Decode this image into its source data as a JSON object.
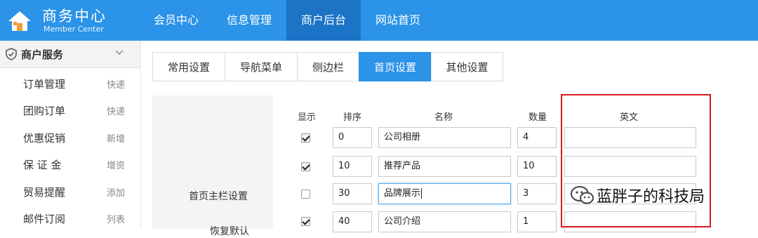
{
  "header": {
    "brand_title": "商务中心",
    "brand_subtitle": "Member Center",
    "nav": [
      {
        "label": "会员中心",
        "active": false
      },
      {
        "label": "信息管理",
        "active": false
      },
      {
        "label": "商户后台",
        "active": true
      },
      {
        "label": "网站首页",
        "active": false
      }
    ]
  },
  "sidebar": {
    "section_label": "商户服务",
    "items": [
      {
        "label": "订单管理",
        "tag": "快递"
      },
      {
        "label": "团购订单",
        "tag": "快递"
      },
      {
        "label": "优惠促销",
        "tag": "新增"
      },
      {
        "label": "保 证 金",
        "tag": "增资"
      },
      {
        "label": "贸易提醒",
        "tag": "添加"
      },
      {
        "label": "邮件订阅",
        "tag": "列表"
      }
    ]
  },
  "tabs": [
    {
      "label": "常用设置",
      "active": false
    },
    {
      "label": "导航菜单",
      "active": false
    },
    {
      "label": "侧边栏",
      "active": false
    },
    {
      "label": "首页设置",
      "active": true
    },
    {
      "label": "其他设置",
      "active": false
    }
  ],
  "settings": {
    "section_label": "首页主栏设置",
    "section_label_2": "恢复默认",
    "columns": {
      "show": "显示",
      "order": "排序",
      "name": "名称",
      "count": "数量",
      "english": "英文"
    },
    "rows": [
      {
        "show": true,
        "order": "0",
        "name": "公司相册",
        "count": "4",
        "english": ""
      },
      {
        "show": true,
        "order": "10",
        "name": "推荐产品",
        "count": "10",
        "english": ""
      },
      {
        "show": false,
        "order": "30",
        "name": "品牌展示",
        "count": "3",
        "english": ""
      },
      {
        "show": true,
        "order": "40",
        "name": "公司介绍",
        "count": "1",
        "english": ""
      }
    ]
  },
  "watermark": {
    "text": "蓝胖子的科技局"
  },
  "colors": {
    "primary": "#2b93e8",
    "primary_dark": "#1c74c6",
    "highlight_border": "#d71c1c"
  }
}
